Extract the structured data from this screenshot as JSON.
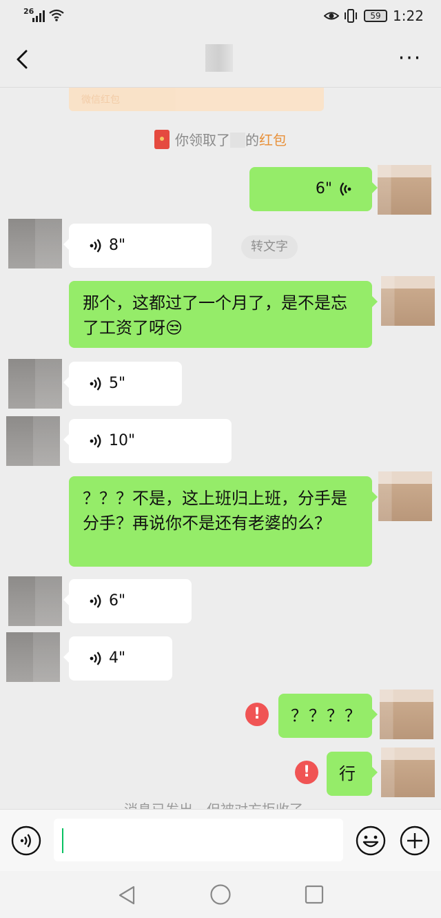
{
  "status_bar": {
    "network": "26",
    "battery": "59",
    "time": "1:22"
  },
  "nav": {
    "back_icon": "chevron-left-icon",
    "more": "···"
  },
  "chat": {
    "top_redpacket_label": "微信红包",
    "system_message": {
      "prefix": "你领取了",
      "suffix": "的",
      "highlight": "红包"
    },
    "messages": [
      {
        "side": "right",
        "type": "voice",
        "duration": "6\""
      },
      {
        "side": "left",
        "type": "voice",
        "duration": "8\""
      },
      {
        "side": "right",
        "type": "text",
        "text": "那个，这都过了一个月了，是不是忘了工资了呀😒"
      },
      {
        "side": "left",
        "type": "voice",
        "duration": "5\""
      },
      {
        "side": "left",
        "type": "voice",
        "duration": "10\""
      },
      {
        "side": "right",
        "type": "text",
        "text": "？？？不是，这上班归上班，分手是分手？再说你不是还有老婆的么？"
      },
      {
        "side": "left",
        "type": "voice",
        "duration": "6\""
      },
      {
        "side": "left",
        "type": "voice",
        "duration": "4\""
      },
      {
        "side": "right",
        "type": "text",
        "text": "？？？？",
        "failed": true
      },
      {
        "side": "right",
        "type": "text",
        "text": "行",
        "failed": true
      }
    ],
    "convert_to_text": "转文字",
    "rejected_notice": "消息已发出，但被对方拒收了。",
    "error_mark": "!"
  },
  "input_bar": {
    "voice_icon": "voice-input-icon",
    "emoji_icon": "emoji-icon",
    "plus_icon": "plus-icon"
  },
  "colors": {
    "bubble_right": "#95ec69",
    "bubble_left": "#ffffff",
    "background": "#ededed",
    "error": "#f05454",
    "highlight": "#e8913a"
  }
}
